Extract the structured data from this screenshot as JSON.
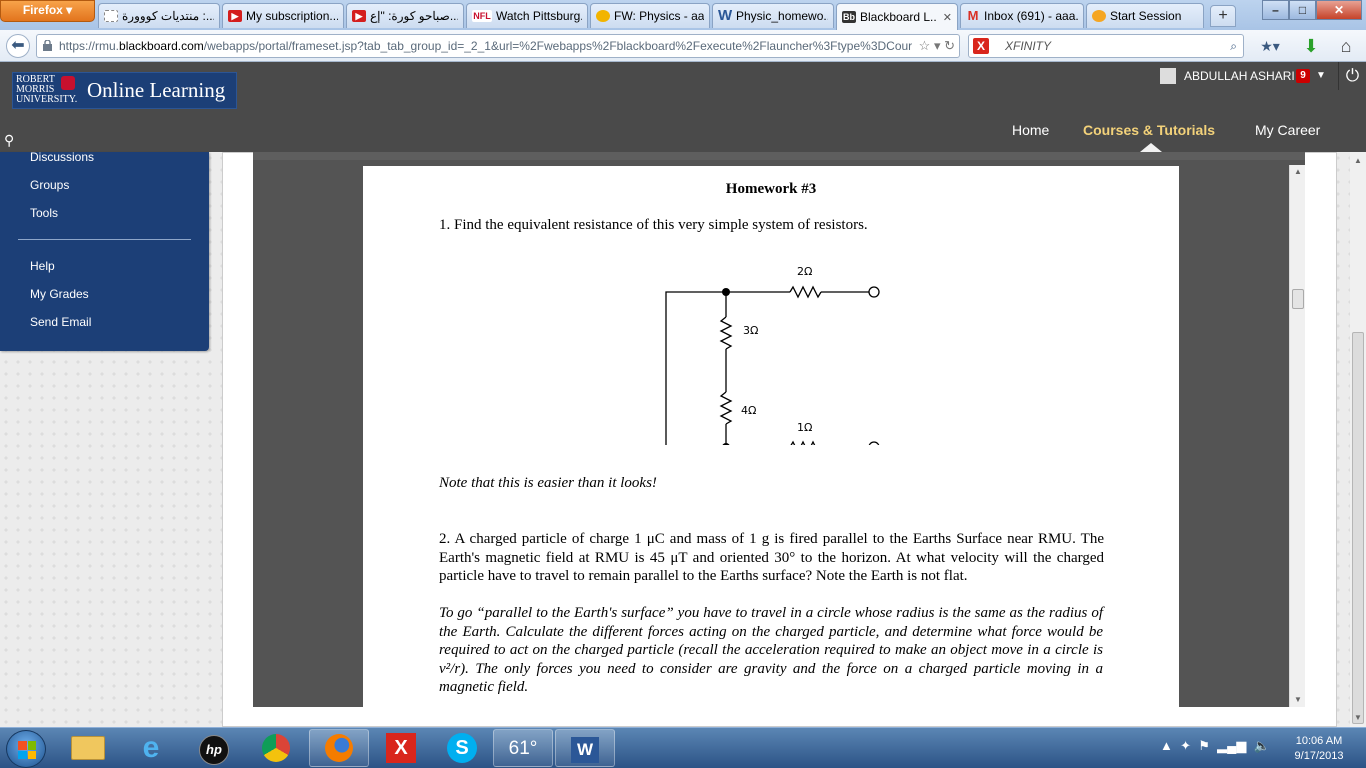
{
  "browser": {
    "menu_label": "Firefox",
    "tabs": [
      {
        "label": "منتديات كووورة :...",
        "icon": "page-icon"
      },
      {
        "label": "My subscription...",
        "icon": "youtube-icon"
      },
      {
        "label": "صباحو كورة: \"إع...",
        "icon": "youtube-icon"
      },
      {
        "label": "Watch Pittsburg...",
        "icon": "nfl-icon"
      },
      {
        "label": "FW: Physics - aa...",
        "icon": "outlook-icon"
      },
      {
        "label": "Physic_homewo...",
        "icon": "word-icon"
      },
      {
        "label": "Blackboard L...",
        "icon": "blackboard-icon",
        "active": true
      },
      {
        "label": "Inbox (691) - aaa...",
        "icon": "gmail-icon"
      },
      {
        "label": "Start Session",
        "icon": "session-icon"
      }
    ],
    "new_tab_label": "+",
    "url_prefix": "https://rmu.",
    "url_domain": "blackboard.com",
    "url_rest": "/webapps/portal/frameset.jsp?tab_tab_group_id=_2_1&url=%2Fwebapps%2Fblackboard%2Fexecute%2Flauncher%3Ftype%3DCour",
    "search_engine": "XFINITY"
  },
  "header": {
    "logo_univ_line1": "ROBERT",
    "logo_univ_line2": "MORRIS",
    "logo_univ_line3": "UNIVERSITY.",
    "logo_title": "Online Learning",
    "user_name": "ABDULLAH ASHARI",
    "notification_count": "9",
    "nav": [
      {
        "label": "Home"
      },
      {
        "label": "Courses & Tutorials",
        "active": true
      },
      {
        "label": "My Career"
      }
    ]
  },
  "sidebar": {
    "items": [
      {
        "label": "Discussions"
      },
      {
        "label": "Groups"
      },
      {
        "label": "Tools"
      },
      {
        "label": "Help"
      },
      {
        "label": "My Grades"
      },
      {
        "label": "Send Email"
      }
    ]
  },
  "document": {
    "title": "Homework #3",
    "q1": "1. Find the equivalent resistance of this very simple system of resistors.",
    "circuit": {
      "r_top": "2Ω",
      "r_left_upper": "3Ω",
      "r_left_lower": "4Ω",
      "r_bottom": "1Ω"
    },
    "note": "Note that this is easier than it looks!",
    "q2": "2. A charged particle of charge 1 μC and mass of 1 g is fired parallel to the Earths Surface near RMU. The Earth's magnetic field at RMU is 45 μT and oriented 30° to the horizon. At what velocity will the charged particle have to travel to remain parallel to the Earths surface? Note the Earth is not flat.",
    "hint": "To go “parallel to the Earth's surface” you have to travel in a circle whose radius is the same as the radius of the Earth. Calculate the different forces acting on the charged particle, and determine what force would be required to act on the charged particle (recall the acceleration required to make an object move in a circle is v²/r). The only forces you need to consider are gravity and the force on a charged particle moving in a magnetic field."
  },
  "taskbar": {
    "weather": "61°",
    "time": "10:06 AM",
    "date": "9/17/2013"
  }
}
